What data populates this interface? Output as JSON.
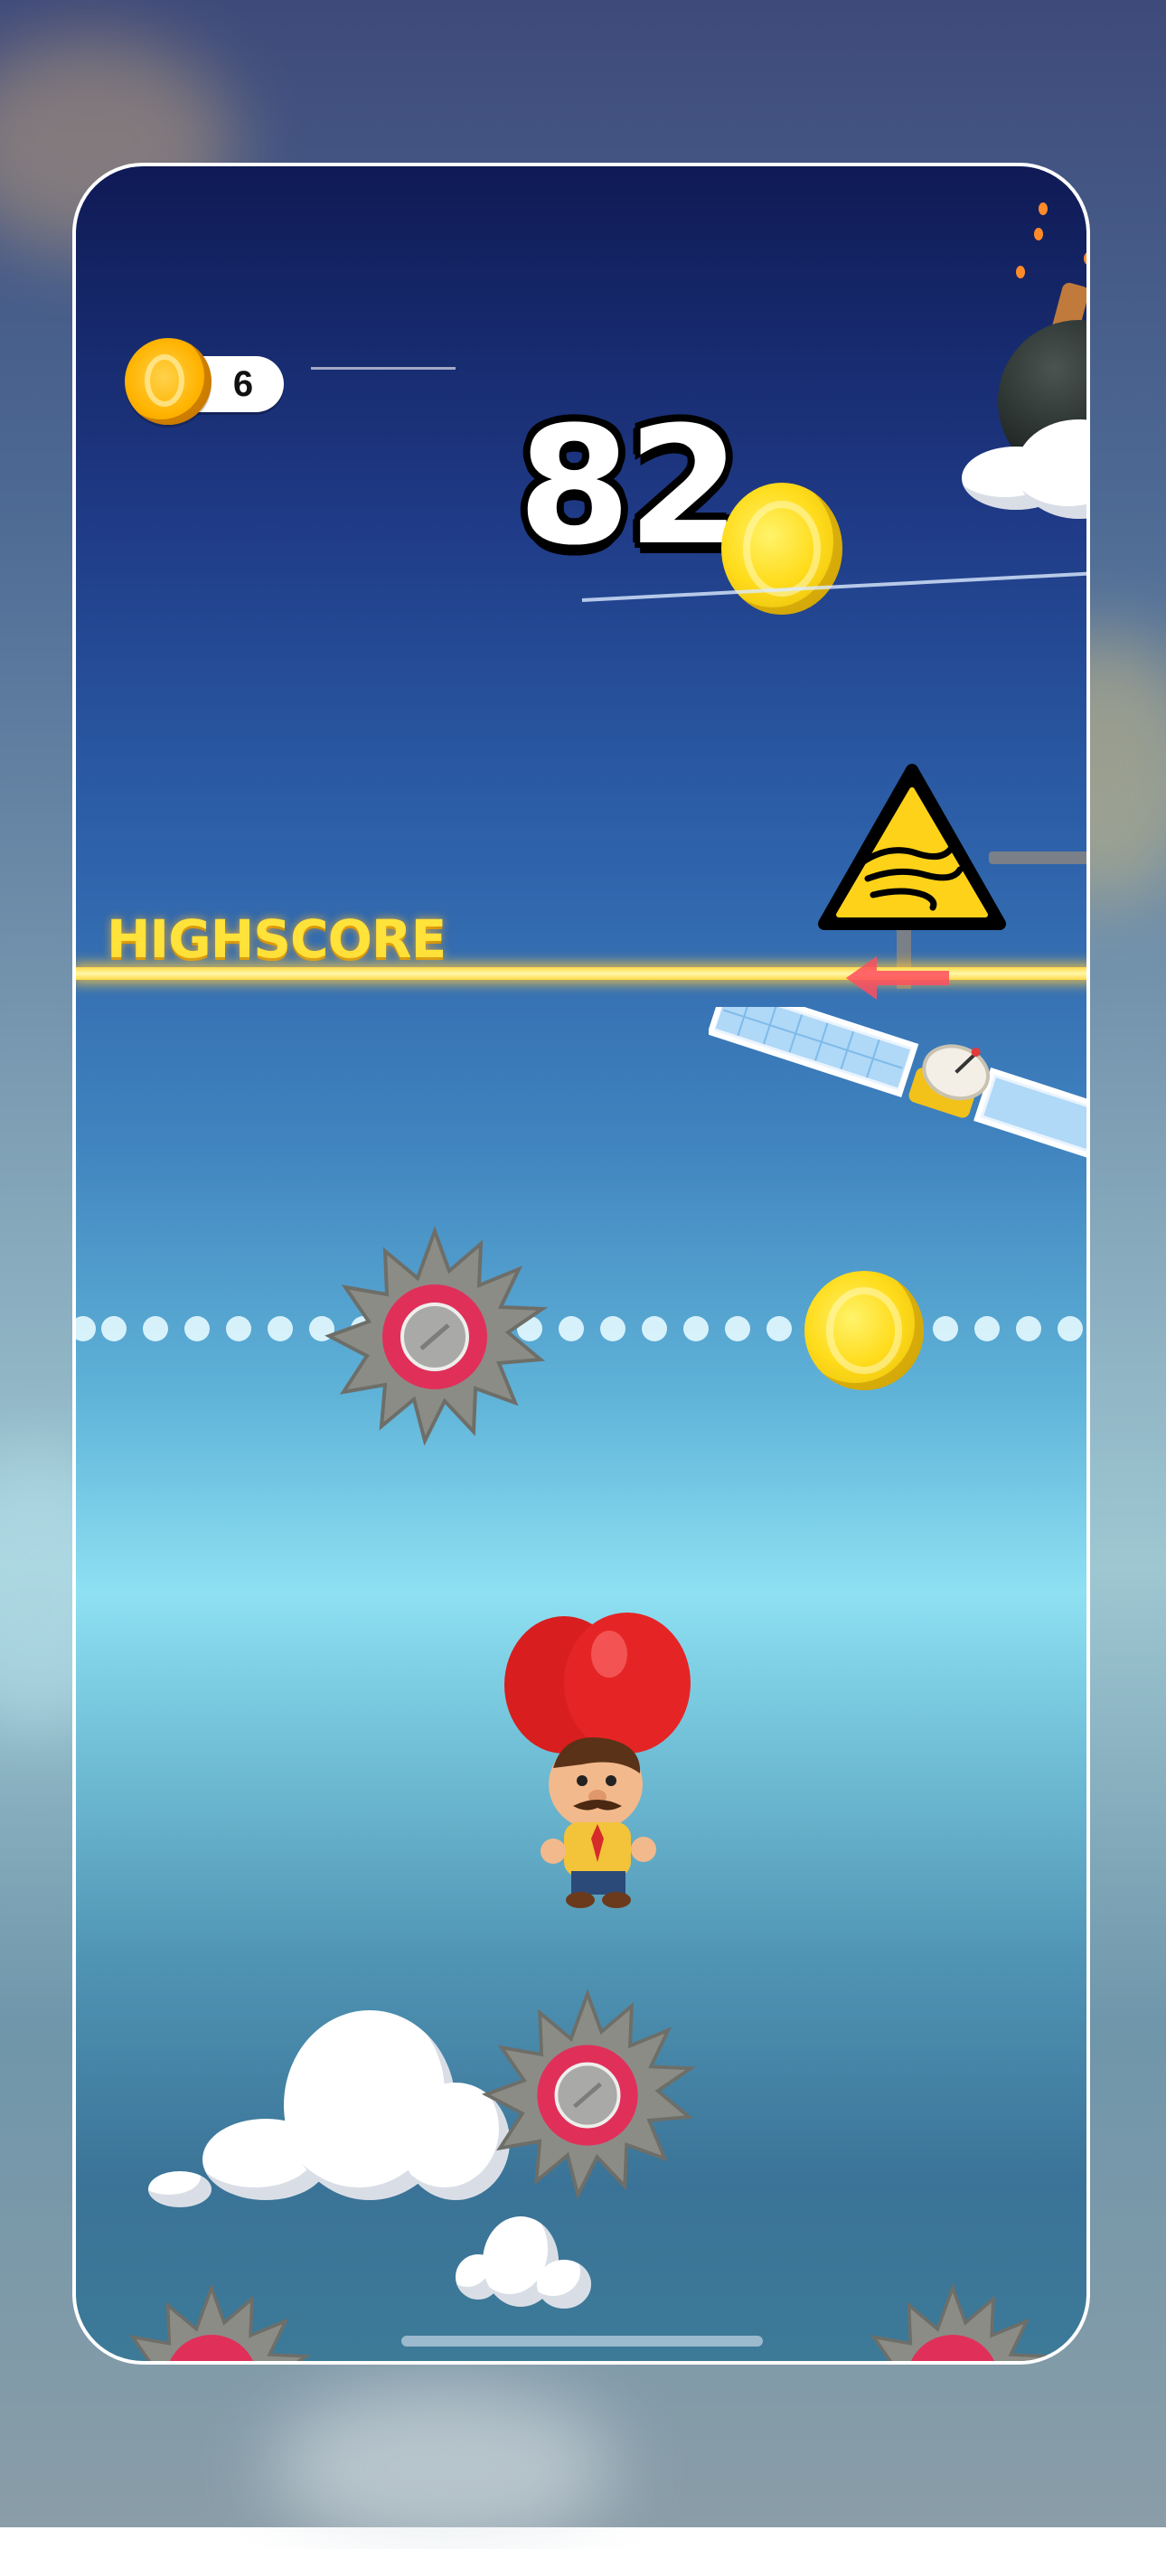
{
  "hud": {
    "coin_count": "6",
    "score": "82"
  },
  "highscore": {
    "label": "HIGHSCORE"
  },
  "icons": {
    "coin": "coin-icon",
    "warning": "wind-warning-icon",
    "hazard": "saw-blade-icon",
    "player": "balloon-character"
  },
  "colors": {
    "highscore_line": "#ffd94a",
    "coin_gold": "#ffdc1c",
    "saw_hub": "#e0305a"
  }
}
